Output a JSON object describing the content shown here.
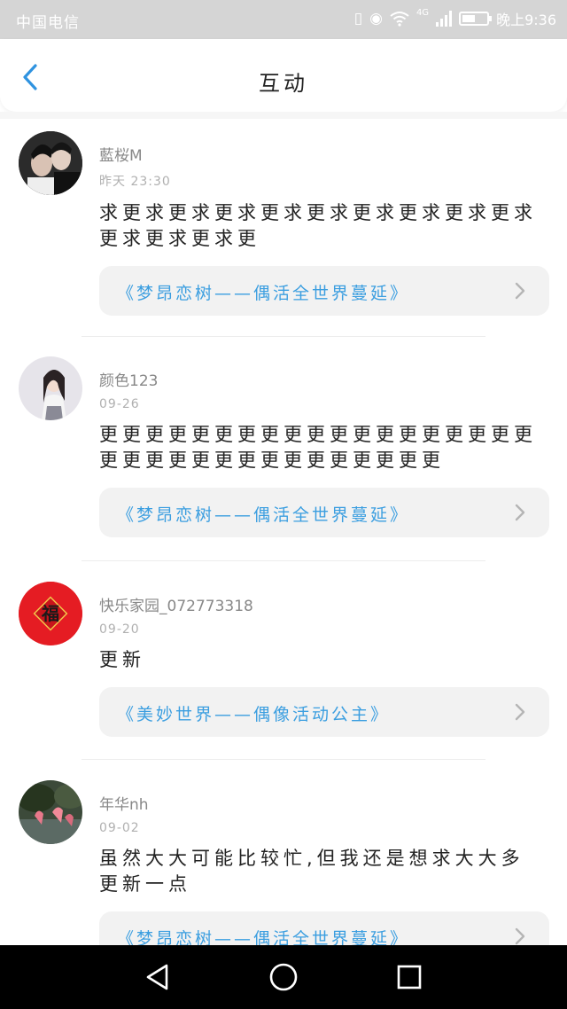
{
  "status_bar": {
    "carrier": "中国电信",
    "network": "4G",
    "time": "晚上9:36",
    "battery_level": 0.55
  },
  "header": {
    "title": "互动",
    "back_icon": "chevron-left-icon",
    "accent": "#2f93e0"
  },
  "comments": [
    {
      "username": "藍桜M",
      "date": "昨天 23:30",
      "content": "求更求更求更求更求更求更求更求更求更求更求更求更求更",
      "book": "《梦昂恋树——偶活全世界蔓延》"
    },
    {
      "username": "颜色123",
      "date": "09-26",
      "content": "更更更更更更更更更更更更更更更更更更更更更更更更更更更更更更更更更更",
      "book": "《梦昂恋树——偶活全世界蔓延》"
    },
    {
      "username": "快乐家园_072773318",
      "date": "09-20",
      "content": "更新",
      "book": "《美妙世界——偶像活动公主》",
      "avatar_text": "福"
    },
    {
      "username": "年华nh",
      "date": "09-02",
      "content": "虽然大大可能比较忙,但我还是想求大大多更新一点",
      "book": "《梦昂恋树——偶活全世界蔓延》"
    }
  ],
  "nav": {
    "back": "triangle-back-icon",
    "home": "circle-home-icon",
    "recents": "square-recents-icon"
  }
}
